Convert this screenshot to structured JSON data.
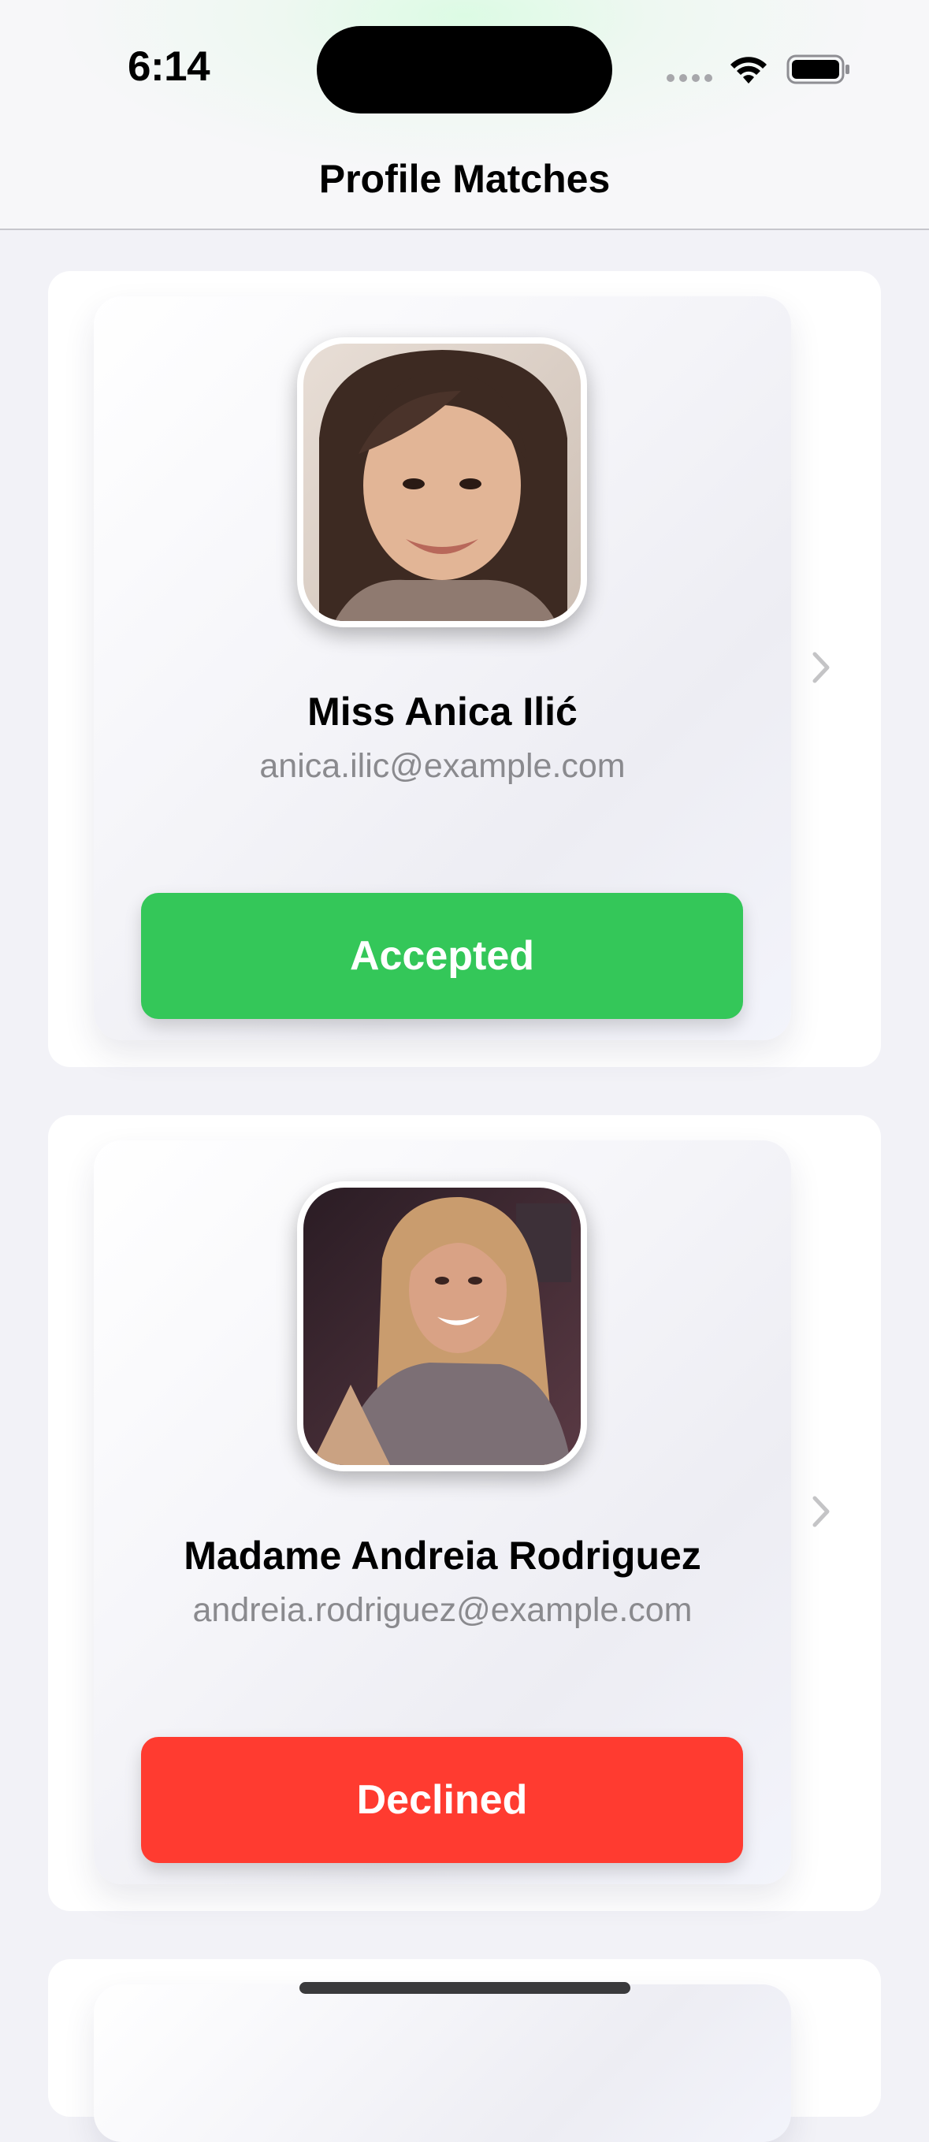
{
  "status_bar": {
    "time": "6:14"
  },
  "nav": {
    "title": "Profile Matches"
  },
  "matches": [
    {
      "name": "Miss Anica Ilić",
      "email": "anica.ilic@example.com",
      "status": "Accepted",
      "status_color": "#34c759"
    },
    {
      "name": "Madame Andreia Rodriguez",
      "email": "andreia.rodriguez@example.com",
      "status": "Declined",
      "status_color": "#ff3b30"
    }
  ],
  "icons": {
    "wifi": "wifi-icon",
    "battery": "battery-icon",
    "chevron": "chevron-right-icon"
  },
  "colors": {
    "accepted": "#34c759",
    "declined": "#ff3b30",
    "background": "#f2f2f7"
  }
}
